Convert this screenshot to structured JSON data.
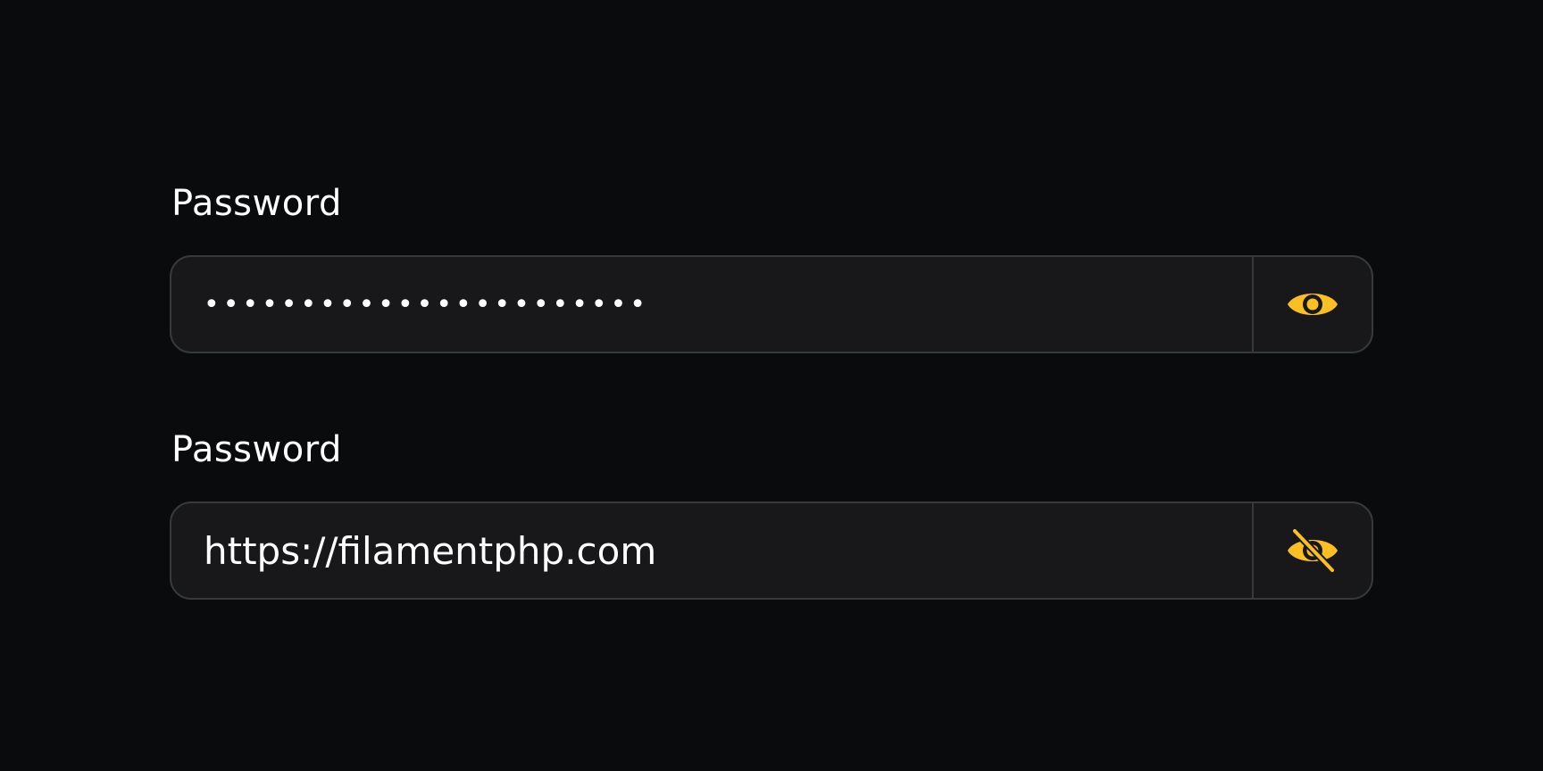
{
  "fields": [
    {
      "label": "Password",
      "value": "•••••••••••••••••••••••",
      "masked": true,
      "toggle_icon": "eye-icon"
    },
    {
      "label": "Password",
      "value": "https://filamentphp.com",
      "masked": false,
      "toggle_icon": "eye-slash-icon"
    }
  ],
  "colors": {
    "background": "#0a0b0d",
    "input_background": "#18181a",
    "border": "#38393b",
    "accent": "#fbbf24",
    "text": "#ffffff"
  }
}
